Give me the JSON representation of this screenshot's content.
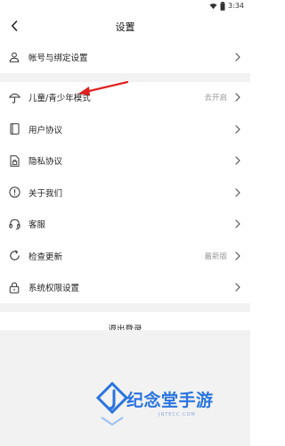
{
  "status_bar": {
    "time": "3:34",
    "icons": [
      "wifi-icon",
      "battery-icon"
    ]
  },
  "header": {
    "title": "设置",
    "back_icon": "chevron-left-icon"
  },
  "rows_group1": [
    {
      "icon": "person-icon",
      "label": "帐号与绑定设置",
      "value": ""
    }
  ],
  "rows_group2": [
    {
      "icon": "umbrella-icon",
      "label": "儿童/青少年模式",
      "value": "去开启"
    },
    {
      "icon": "book-icon",
      "label": "用户协议",
      "value": ""
    },
    {
      "icon": "lock-doc-icon",
      "label": "隐私协议",
      "value": ""
    },
    {
      "icon": "info-icon",
      "label": "关于我们",
      "value": ""
    },
    {
      "icon": "headset-icon",
      "label": "客服",
      "value": ""
    },
    {
      "icon": "refresh-icon",
      "label": "检查更新",
      "value": "最新版"
    },
    {
      "icon": "padlock-icon",
      "label": "系统权限设置",
      "value": ""
    }
  ],
  "logout": {
    "label": "退出登录"
  },
  "watermark": {
    "text": "纪念堂手游",
    "sub": "JNTECC.COM"
  },
  "colors": {
    "accent_arrow": "#e02020",
    "watermark": "#2a74e0",
    "divider_bg": "#f2f2f2"
  }
}
